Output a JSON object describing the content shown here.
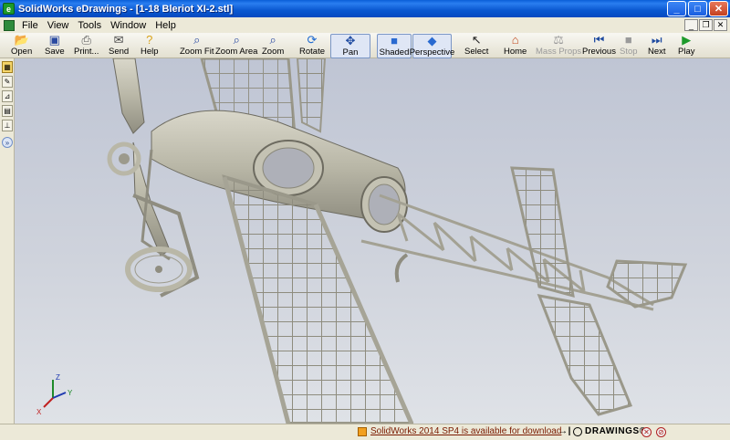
{
  "window": {
    "title": "SolidWorks eDrawings - [1-18 Bleriot XI-2.stl]"
  },
  "menu": {
    "items": [
      "File",
      "View",
      "Tools",
      "Window",
      "Help"
    ]
  },
  "toolbar": {
    "open": "Open",
    "save": "Save",
    "print": "Print...",
    "send": "Send",
    "help": "Help",
    "zoom_fit": "Zoom Fit",
    "zoom_area": "Zoom Area",
    "zoom": "Zoom",
    "rotate": "Rotate",
    "pan": "Pan",
    "shaded": "Shaded",
    "perspective": "Perspective",
    "select": "Select",
    "home": "Home",
    "mass_props": "Mass Props",
    "previous": "Previous",
    "stop": "Stop",
    "next": "Next",
    "play": "Play"
  },
  "status": {
    "message": "SolidWorks 2014 SP4 is available for download",
    "brand": "DRAWINGS®"
  },
  "triad": {
    "x": "X",
    "y": "Y",
    "z": "Z"
  },
  "colors": {
    "titlebar": "#0a58d0",
    "viewport_top": "#bfc5d4",
    "viewport_bottom": "#dfe2e7",
    "model": "#c9c7b8"
  }
}
